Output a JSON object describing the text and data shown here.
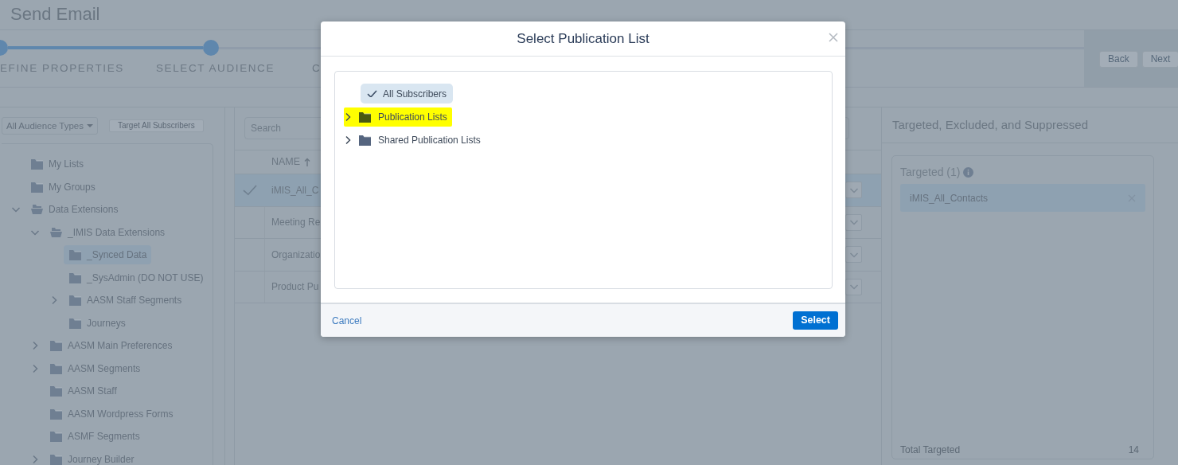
{
  "page": {
    "title": "Send Email"
  },
  "stepper": {
    "steps": [
      {
        "label": "EFINE PROPERTIES",
        "reached": true
      },
      {
        "label": "SELECT AUDIENCE",
        "reached": true
      },
      {
        "label": "C",
        "reached": false
      }
    ],
    "buttons": [
      "Back",
      "Next"
    ]
  },
  "audience_panel": {
    "type_dropdown": "All Audience Types",
    "target_all_button": {
      "label": "Target All Subscribers",
      "disabled": true
    },
    "tree": [
      {
        "label": "My Lists",
        "selected": false
      },
      {
        "label": "My Groups",
        "selected": false
      },
      {
        "label": "Data Extensions",
        "expanded": true,
        "selected": false,
        "children": [
          {
            "label": "_IMIS Data Extensions",
            "expanded": true,
            "selected": false,
            "children": [
              {
                "label": "_Synced Data",
                "selected": true
              },
              {
                "label": "_SysAdmin (DO NOT USE)",
                "selected": false
              },
              {
                "label": "AASM Staff Segments",
                "expanded": false,
                "selected": false
              },
              {
                "label": "Journeys",
                "selected": false
              }
            ]
          },
          {
            "label": "AASM Main Preferences",
            "expanded": false,
            "selected": false
          },
          {
            "label": "AASM Segments",
            "expanded": false,
            "selected": false
          },
          {
            "label": "AASM Staff",
            "selected": false
          },
          {
            "label": "AASM Wordpress Forms",
            "selected": false
          },
          {
            "label": "ASMF Segments",
            "selected": false
          },
          {
            "label": "Journey Builder",
            "expanded": false,
            "selected": false
          }
        ]
      }
    ]
  },
  "list_panel": {
    "search": {
      "placeholder": "Search"
    },
    "column": "NAME",
    "rows": [
      {
        "name": "iMIS_All_C",
        "selected": true
      },
      {
        "name": "Meeting Re",
        "selected": false
      },
      {
        "name": "Organizatio",
        "selected": false
      },
      {
        "name": "Product Pu",
        "selected": false
      }
    ]
  },
  "summary_panel": {
    "title": "Targeted, Excluded, and Suppressed",
    "targeted_heading": "Targeted (1)",
    "targeted": [
      "iMIS_All_Contacts"
    ],
    "total_label": "Total Targeted",
    "total": "14"
  },
  "dialog": {
    "title": "Select Publication List",
    "items": [
      {
        "label": "All Subscribers",
        "kind": "option",
        "selected": true
      },
      {
        "label": "Publication Lists",
        "kind": "folder",
        "highlighted": true
      },
      {
        "label": "Shared Publication Lists",
        "kind": "folder",
        "highlighted": false
      }
    ],
    "cancel": "Cancel",
    "confirm": "Select"
  }
}
